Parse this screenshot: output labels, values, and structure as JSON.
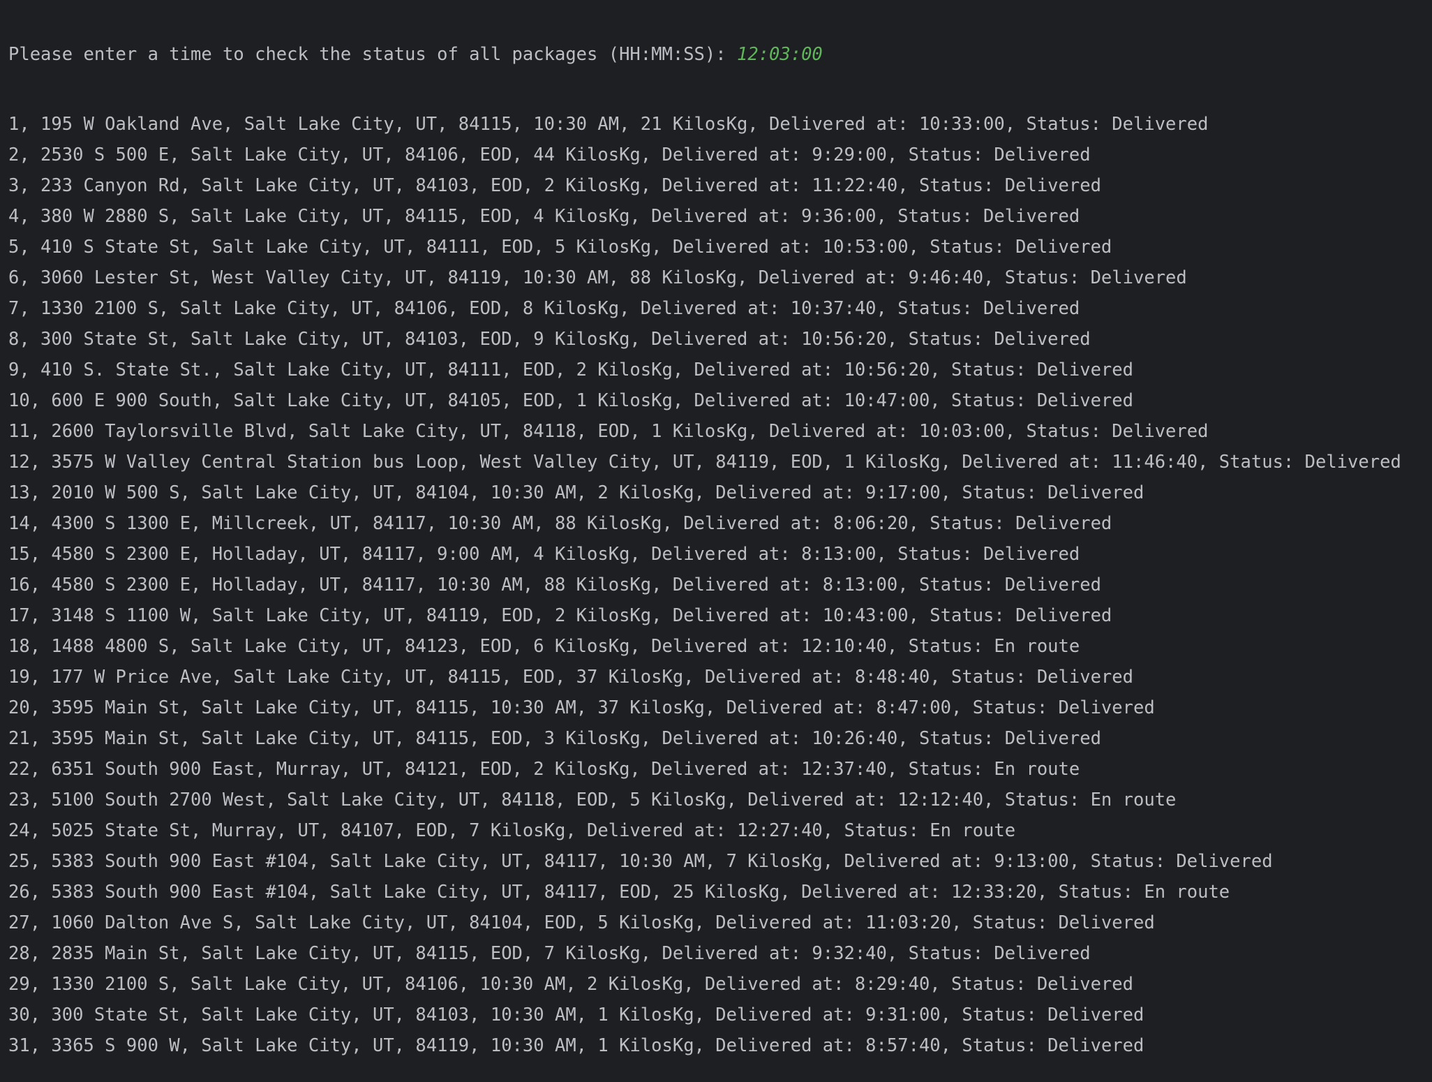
{
  "console": {
    "prompt": "Please enter a time to check the status of all packages (HH:MM:SS): ",
    "input_value": "12:03:00",
    "input_color": "#5fb65a",
    "text_color": "#bcbec4",
    "background": "#1e1f22",
    "lines": [
      "1, 195 W Oakland Ave, Salt Lake City, UT, 84115, 10:30 AM, 21 KilosKg, Delivered at: 10:33:00, Status: Delivered",
      "2, 2530 S 500 E, Salt Lake City, UT, 84106, EOD, 44 KilosKg, Delivered at: 9:29:00, Status: Delivered",
      "3, 233 Canyon Rd, Salt Lake City, UT, 84103, EOD, 2 KilosKg, Delivered at: 11:22:40, Status: Delivered",
      "4, 380 W 2880 S, Salt Lake City, UT, 84115, EOD, 4 KilosKg, Delivered at: 9:36:00, Status: Delivered",
      "5, 410 S State St, Salt Lake City, UT, 84111, EOD, 5 KilosKg, Delivered at: 10:53:00, Status: Delivered",
      "6, 3060 Lester St, West Valley City, UT, 84119, 10:30 AM, 88 KilosKg, Delivered at: 9:46:40, Status: Delivered",
      "7, 1330 2100 S, Salt Lake City, UT, 84106, EOD, 8 KilosKg, Delivered at: 10:37:40, Status: Delivered",
      "8, 300 State St, Salt Lake City, UT, 84103, EOD, 9 KilosKg, Delivered at: 10:56:20, Status: Delivered",
      "9, 410 S. State St., Salt Lake City, UT, 84111, EOD, 2 KilosKg, Delivered at: 10:56:20, Status: Delivered",
      "10, 600 E 900 South, Salt Lake City, UT, 84105, EOD, 1 KilosKg, Delivered at: 10:47:00, Status: Delivered",
      "11, 2600 Taylorsville Blvd, Salt Lake City, UT, 84118, EOD, 1 KilosKg, Delivered at: 10:03:00, Status: Delivered",
      "12, 3575 W Valley Central Station bus Loop, West Valley City, UT, 84119, EOD, 1 KilosKg, Delivered at: 11:46:40, Status: Delivered",
      "13, 2010 W 500 S, Salt Lake City, UT, 84104, 10:30 AM, 2 KilosKg, Delivered at: 9:17:00, Status: Delivered",
      "14, 4300 S 1300 E, Millcreek, UT, 84117, 10:30 AM, 88 KilosKg, Delivered at: 8:06:20, Status: Delivered",
      "15, 4580 S 2300 E, Holladay, UT, 84117, 9:00 AM, 4 KilosKg, Delivered at: 8:13:00, Status: Delivered",
      "16, 4580 S 2300 E, Holladay, UT, 84117, 10:30 AM, 88 KilosKg, Delivered at: 8:13:00, Status: Delivered",
      "17, 3148 S 1100 W, Salt Lake City, UT, 84119, EOD, 2 KilosKg, Delivered at: 10:43:00, Status: Delivered",
      "18, 1488 4800 S, Salt Lake City, UT, 84123, EOD, 6 KilosKg, Delivered at: 12:10:40, Status: En route",
      "19, 177 W Price Ave, Salt Lake City, UT, 84115, EOD, 37 KilosKg, Delivered at: 8:48:40, Status: Delivered",
      "20, 3595 Main St, Salt Lake City, UT, 84115, 10:30 AM, 37 KilosKg, Delivered at: 8:47:00, Status: Delivered",
      "21, 3595 Main St, Salt Lake City, UT, 84115, EOD, 3 KilosKg, Delivered at: 10:26:40, Status: Delivered",
      "22, 6351 South 900 East, Murray, UT, 84121, EOD, 2 KilosKg, Delivered at: 12:37:40, Status: En route",
      "23, 5100 South 2700 West, Salt Lake City, UT, 84118, EOD, 5 KilosKg, Delivered at: 12:12:40, Status: En route",
      "24, 5025 State St, Murray, UT, 84107, EOD, 7 KilosKg, Delivered at: 12:27:40, Status: En route",
      "25, 5383 South 900 East #104, Salt Lake City, UT, 84117, 10:30 AM, 7 KilosKg, Delivered at: 9:13:00, Status: Delivered",
      "26, 5383 South 900 East #104, Salt Lake City, UT, 84117, EOD, 25 KilosKg, Delivered at: 12:33:20, Status: En route",
      "27, 1060 Dalton Ave S, Salt Lake City, UT, 84104, EOD, 5 KilosKg, Delivered at: 11:03:20, Status: Delivered",
      "28, 2835 Main St, Salt Lake City, UT, 84115, EOD, 7 KilosKg, Delivered at: 9:32:40, Status: Delivered",
      "29, 1330 2100 S, Salt Lake City, UT, 84106, 10:30 AM, 2 KilosKg, Delivered at: 8:29:40, Status: Delivered",
      "30, 300 State St, Salt Lake City, UT, 84103, 10:30 AM, 1 KilosKg, Delivered at: 9:31:00, Status: Delivered",
      "31, 3365 S 900 W, Salt Lake City, UT, 84119, 10:30 AM, 1 KilosKg, Delivered at: 8:57:40, Status: Delivered"
    ]
  }
}
